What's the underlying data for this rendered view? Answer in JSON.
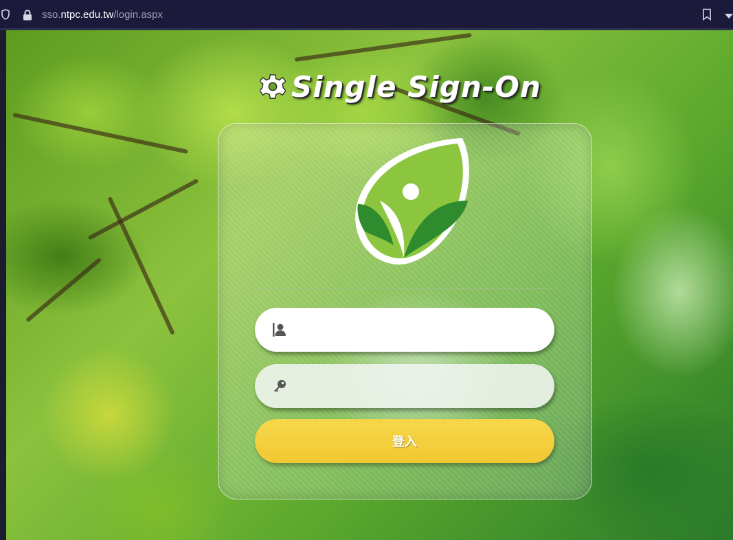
{
  "browser": {
    "url_prefix": "sso.",
    "url_host": "ntpc.edu.tw",
    "url_path": "/login.aspx"
  },
  "page": {
    "title": "Single Sign-On",
    "username_placeholder": "",
    "password_placeholder": "",
    "login_label": "登入"
  },
  "colors": {
    "accent_button": "#f1c832",
    "logo_green": "#8cc63e",
    "logo_dark_green": "#2e8b2e"
  },
  "icons": [
    "shield-icon",
    "lock-icon",
    "bookmark-icon",
    "gear-icon",
    "user-icon",
    "key-icon"
  ]
}
